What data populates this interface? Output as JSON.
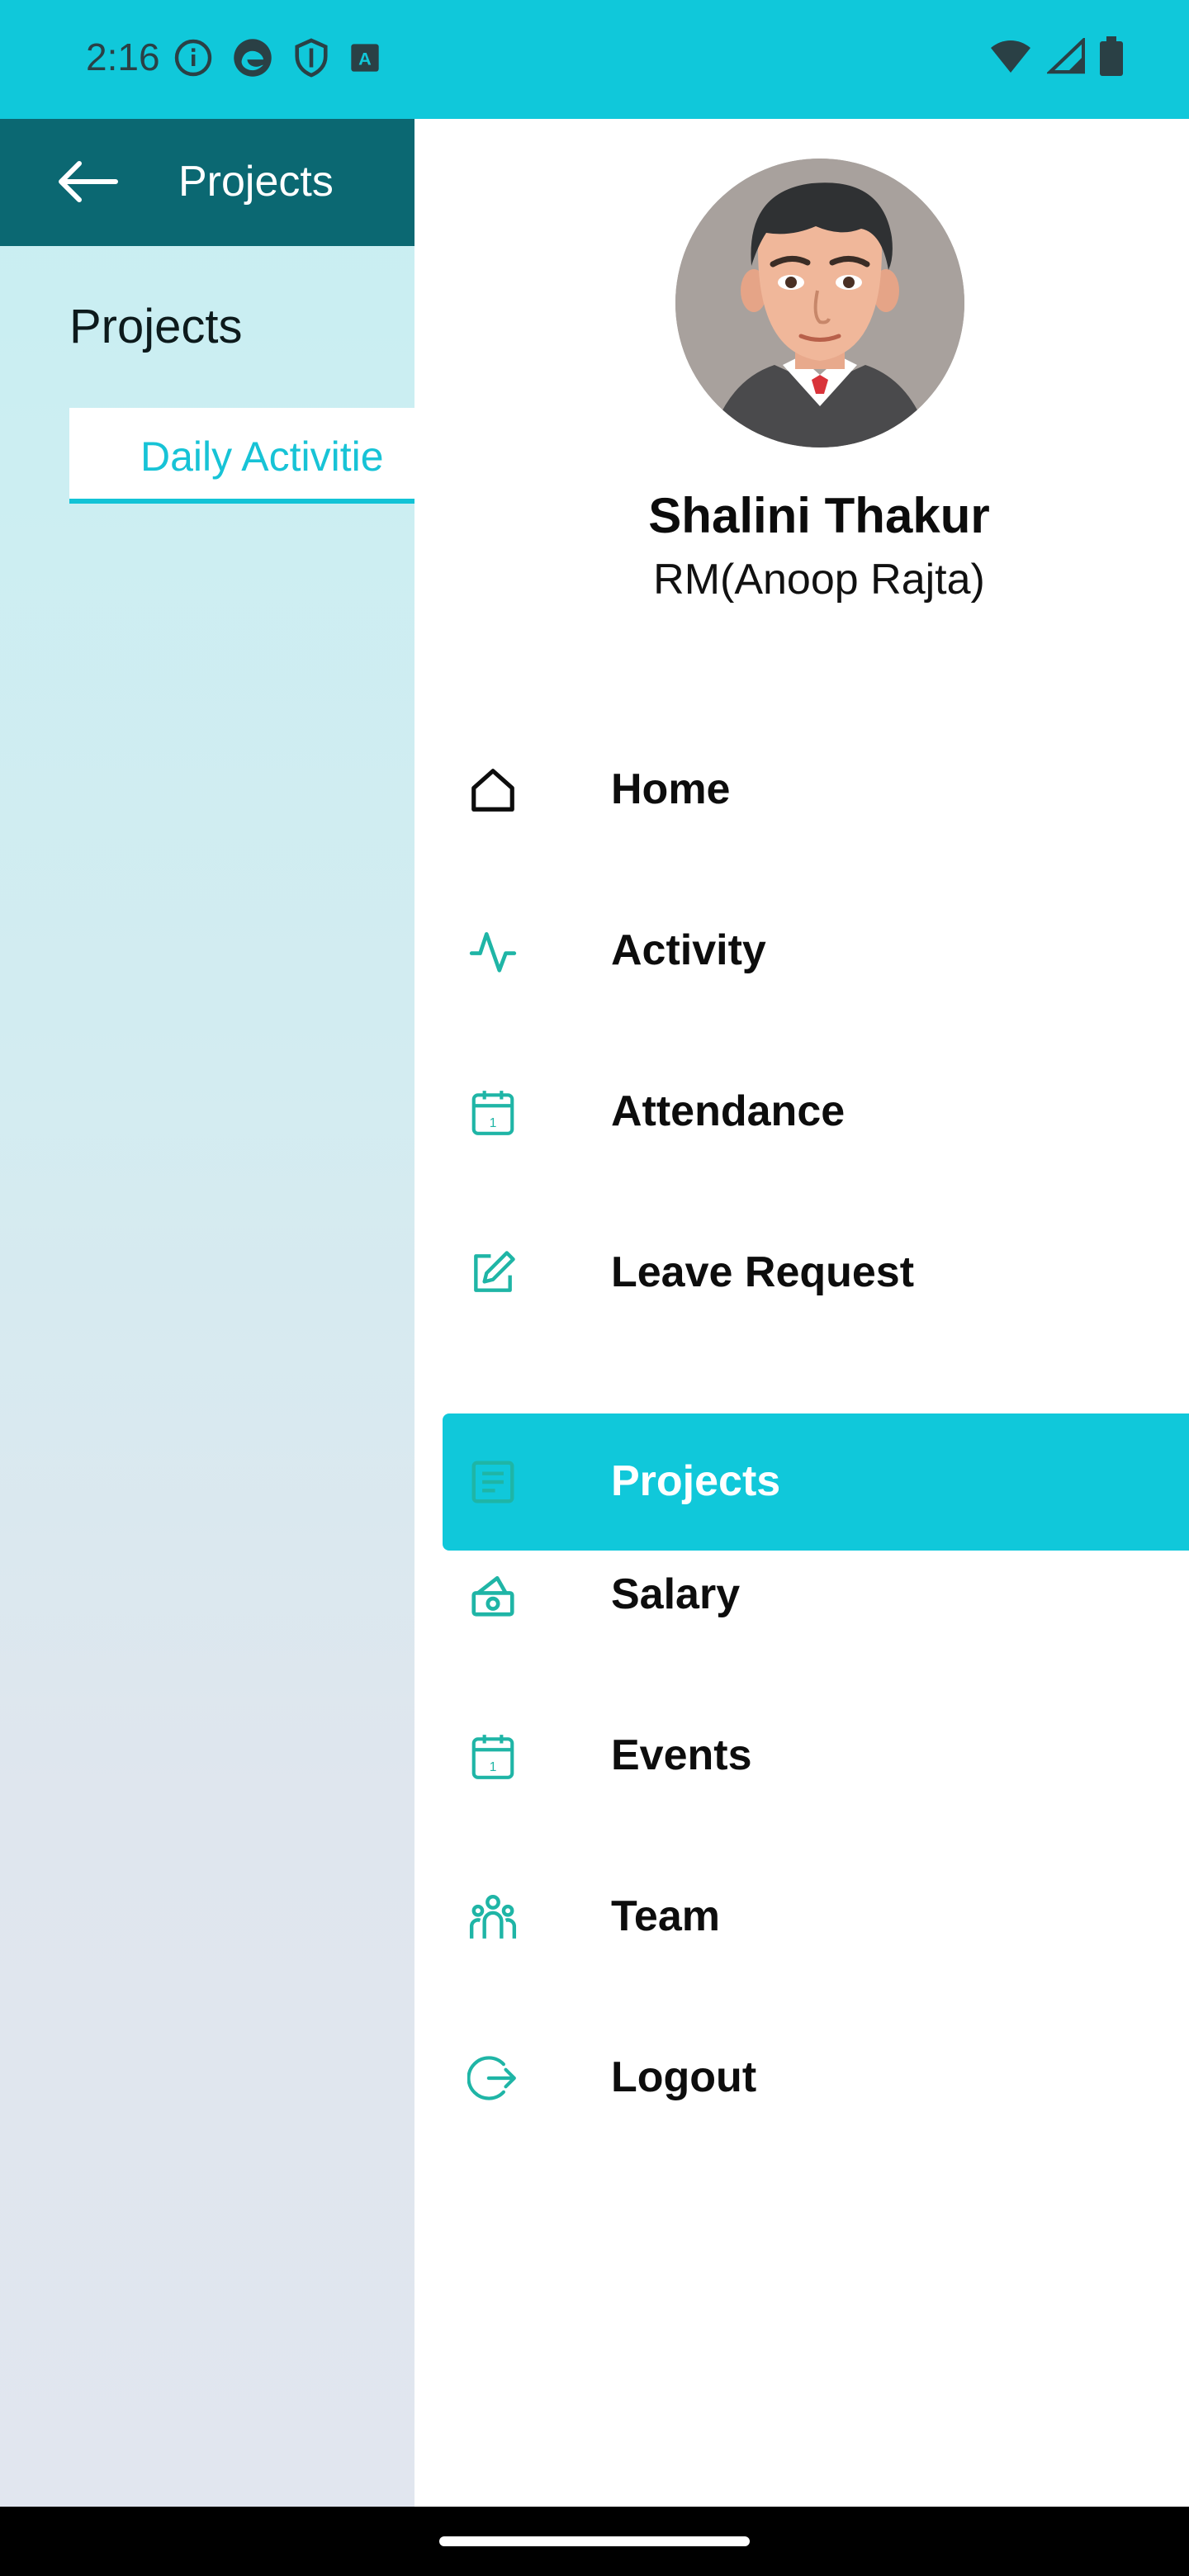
{
  "status_bar": {
    "time": "2:16",
    "icons": [
      "info-icon",
      "edge-browser-icon",
      "shield-icon",
      "keyboard-a-icon"
    ],
    "right_icons": [
      "wifi-icon",
      "signal-icon",
      "battery-icon"
    ]
  },
  "background_page": {
    "app_bar": {
      "title": "Projects",
      "back_icon": "back-arrow-icon"
    },
    "heading": "Projects",
    "tab_label": "Daily Activitie"
  },
  "drawer": {
    "profile": {
      "name": "Shalini Thakur",
      "subtitle": "RM(Anoop Rajta)"
    },
    "menu": [
      {
        "label": "Home",
        "icon": "home-icon",
        "active": false
      },
      {
        "label": "Activity",
        "icon": "activity-pulse-icon",
        "active": false
      },
      {
        "label": "Attendance",
        "icon": "calendar-icon",
        "active": false
      },
      {
        "label": "Leave Request",
        "icon": "edit-icon",
        "active": false
      },
      {
        "label": "Projects",
        "icon": "document-icon",
        "active": true
      },
      {
        "label": "Salary",
        "icon": "money-icon",
        "active": false
      },
      {
        "label": "Events",
        "icon": "calendar-icon",
        "active": false
      },
      {
        "label": "Team",
        "icon": "team-icon",
        "active": false
      },
      {
        "label": "Logout",
        "icon": "logout-icon",
        "active": false
      }
    ]
  },
  "colors": {
    "accent": "#10c8da",
    "app_bar": "#0b6872",
    "icon_teal": "#1fb5a6"
  }
}
